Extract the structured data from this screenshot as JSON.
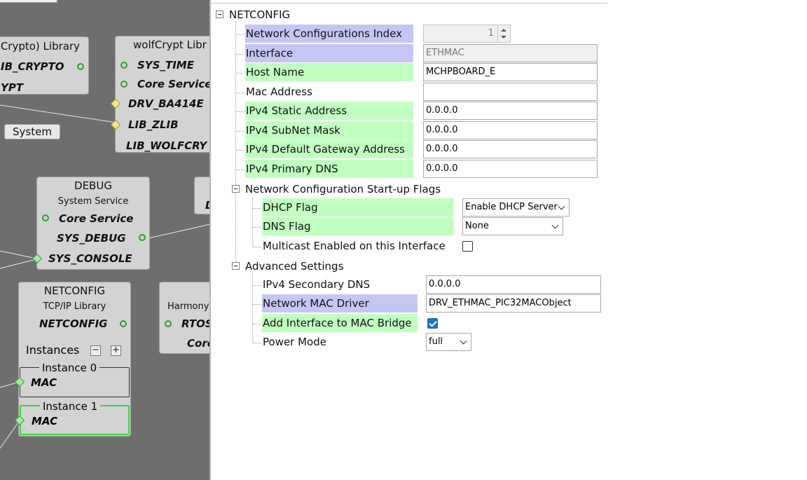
{
  "graph": {
    "system_button": "System",
    "crypto": {
      "title": "Crypto) Library",
      "deps": [
        "IB_CRYPTO",
        "YPT"
      ]
    },
    "wolfcrypt": {
      "title": "wolfCrypt Libr",
      "deps": [
        "SYS_TIME",
        "Core Service",
        "DRV_BA414E",
        "LIB_ZLIB",
        "LIB_WOLFCRY"
      ]
    },
    "debug": {
      "title": "DEBUG",
      "subtitle": "System Service",
      "deps": [
        "Core Service",
        "SYS_DEBUG",
        "SYS_CONSOLE"
      ]
    },
    "netconfig": {
      "title": "NETCONFIG",
      "subtitle": "TCP/IP Library",
      "dep": "NETCONFIG",
      "instances_label": "Instances",
      "minus": "−",
      "plus": "+",
      "instances": [
        {
          "label": "Instance 0",
          "dep": "MAC"
        },
        {
          "label": "Instance 1",
          "dep": "MAC"
        }
      ]
    },
    "harmony": {
      "title": "Harmony",
      "deps": [
        "RTOS",
        "Core"
      ]
    },
    "partial_right": {
      "dep": "D"
    }
  },
  "config": {
    "root": "NETCONFIG",
    "props": {
      "index_label": "Network Configurations Index",
      "index_value": "1",
      "interface_label": "Interface",
      "interface_value": "ETHMAC",
      "host_label": "Host Name",
      "host_value": "MCHPBOARD_E",
      "mac_label": "Mac Address",
      "mac_value": "",
      "ipv4_static_label": "IPv4 Static Address",
      "ipv4_static_value": "0.0.0.0",
      "ipv4_mask_label": "IPv4 SubNet Mask",
      "ipv4_mask_value": "0.0.0.0",
      "ipv4_gw_label": "IPv4 Default Gateway Address",
      "ipv4_gw_value": "0.0.0.0",
      "ipv4_dns_label": "IPv4 Primary DNS",
      "ipv4_dns_value": "0.0.0.0"
    },
    "startup": {
      "title": "Network Configuration Start-up Flags",
      "dhcp_label": "DHCP Flag",
      "dhcp_value": "Enable DHCP Server",
      "dns_label": "DNS Flag",
      "dns_value": "None",
      "multicast_label": "Multicast Enabled on this Interface",
      "multicast_checked": false
    },
    "advanced": {
      "title": "Advanced Settings",
      "sec_dns_label": "IPv4 Secondary DNS",
      "sec_dns_value": "0.0.0.0",
      "mac_driver_label": "Network MAC Driver",
      "mac_driver_value": "DRV_ETHMAC_PIC32MACObject",
      "bridge_label": "Add Interface to MAC Bridge",
      "bridge_checked": true,
      "power_label": "Power Mode",
      "power_value": "full"
    }
  },
  "colors": {
    "canvas_bg": "#6e6e6e",
    "component_bg": "#d3d3d3",
    "label_purple": "#c6c6f5",
    "label_green": "#c1ffc1",
    "checkbox_checked": "#1e6fd0",
    "selected_instance_border": "#3bd63b"
  }
}
